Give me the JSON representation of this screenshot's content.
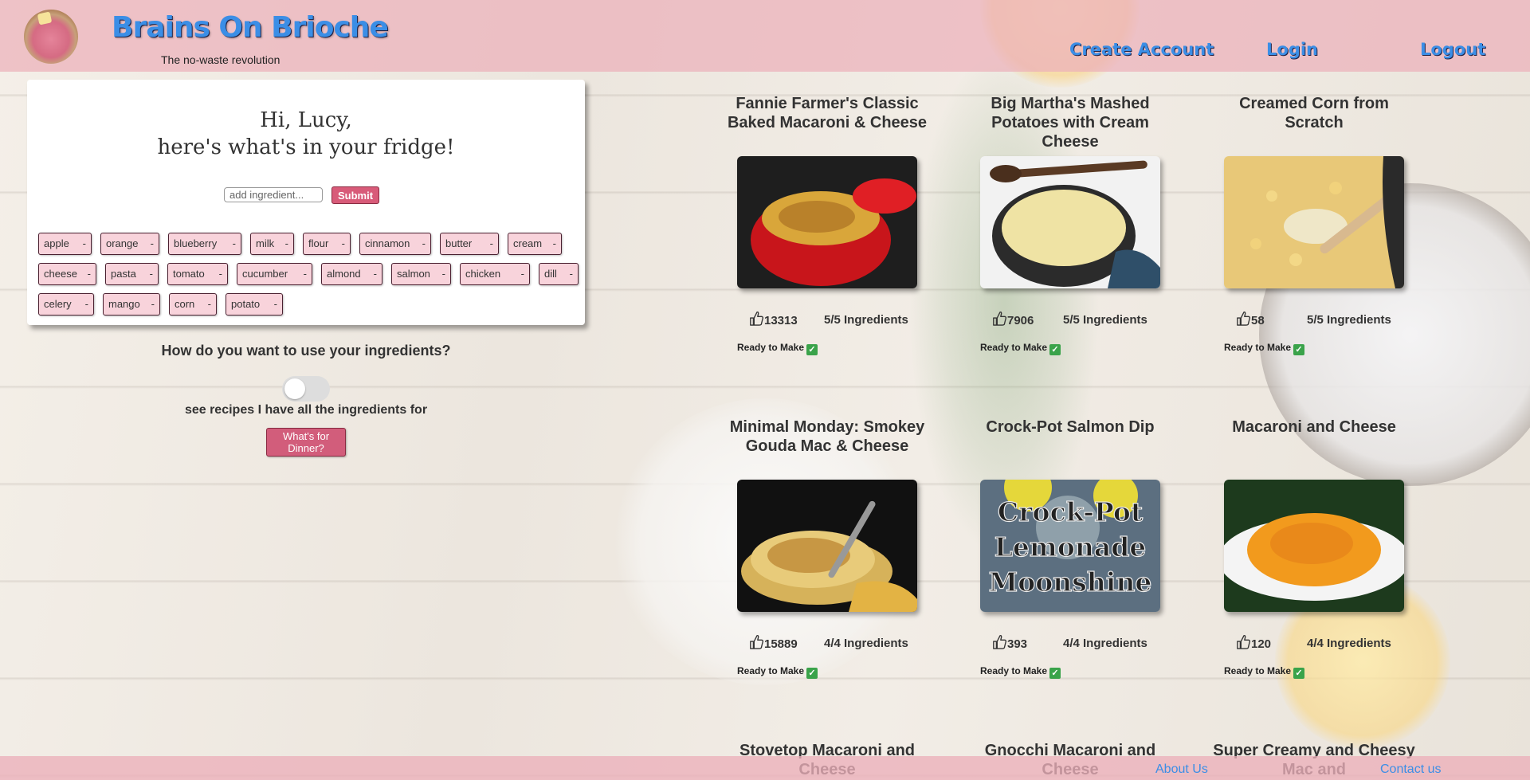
{
  "header": {
    "site_title": "Brains On Brioche",
    "tagline": "The no-waste revolution",
    "nav": [
      "Create Account",
      "Login",
      "Logout"
    ]
  },
  "fridge": {
    "greeting_line1": "Hi, Lucy,",
    "greeting_line2": "here's what's in your fridge!",
    "input_placeholder": "add ingredient...",
    "submit_label": "Submit",
    "remove_symbol": "-",
    "ingredients": [
      "apple",
      "orange",
      "blueberry",
      "milk",
      "flour",
      "cinnamon",
      "butter",
      "cream",
      "cheese",
      "pasta",
      "tomato",
      "cucumber",
      "almond",
      "salmon",
      "chicken",
      "dill",
      "celery",
      "mango",
      "corn",
      "potato"
    ]
  },
  "options": {
    "question": "How do you want to use your ingredients?",
    "toggle_label": "see recipes I have all the ingredients for",
    "toggle_on": false,
    "dinner_button": "What's for Dinner?"
  },
  "recipes": [
    {
      "title": "Fannie Farmer's Classic Baked Macaroni & Cheese",
      "likes": "13313",
      "ingredients": "5/5 Ingredients",
      "status": "Ready to Make",
      "image": "baked-mac-red-pot"
    },
    {
      "title": "Big Martha's Mashed Potatoes with Cream Cheese",
      "likes": "7906",
      "ingredients": "5/5 Ingredients",
      "status": "Ready to Make",
      "image": "mashed-potatoes-pot"
    },
    {
      "title": "Creamed Corn from Scratch",
      "likes": "58",
      "ingredients": "5/5 Ingredients",
      "status": "Ready to Make",
      "image": "creamed-corn-skillet"
    },
    {
      "title": "Minimal Monday: Smokey Gouda Mac & Cheese",
      "likes": "15889",
      "ingredients": "4/4 Ingredients",
      "status": "Ready to Make",
      "image": "gouda-mac-crock"
    },
    {
      "title": "Crock-Pot Salmon Dip",
      "likes": "393",
      "ingredients": "4/4 Ingredients",
      "status": "Ready to Make",
      "image": "crock-pot-lemonade-moonshine"
    },
    {
      "title": "Macaroni and Cheese",
      "likes": "120",
      "ingredients": "4/4 Ingredients",
      "status": "Ready to Make",
      "image": "mac-cheese-plate"
    },
    {
      "title": "Stovetop Macaroni and Cheese",
      "likes": "",
      "ingredients": "",
      "status": "",
      "image": ""
    },
    {
      "title": "Gnocchi Macaroni and Cheese",
      "likes": "",
      "ingredients": "",
      "status": "",
      "image": ""
    },
    {
      "title": "Super Creamy and Cheesy Mac and",
      "likes": "",
      "ingredients": "",
      "status": "",
      "image": ""
    }
  ],
  "recipe_image_text": {
    "crock_pot": [
      "Crock-Pot",
      "Lemonade",
      "Moonshine"
    ]
  },
  "footer": {
    "about": "About Us",
    "contact": "Contact us"
  },
  "colors": {
    "header_pink": "#ecb0ba",
    "brand_blue": "#3b8ee6",
    "button_pink": "#d85b79",
    "chip_pink": "#f8d3db"
  }
}
